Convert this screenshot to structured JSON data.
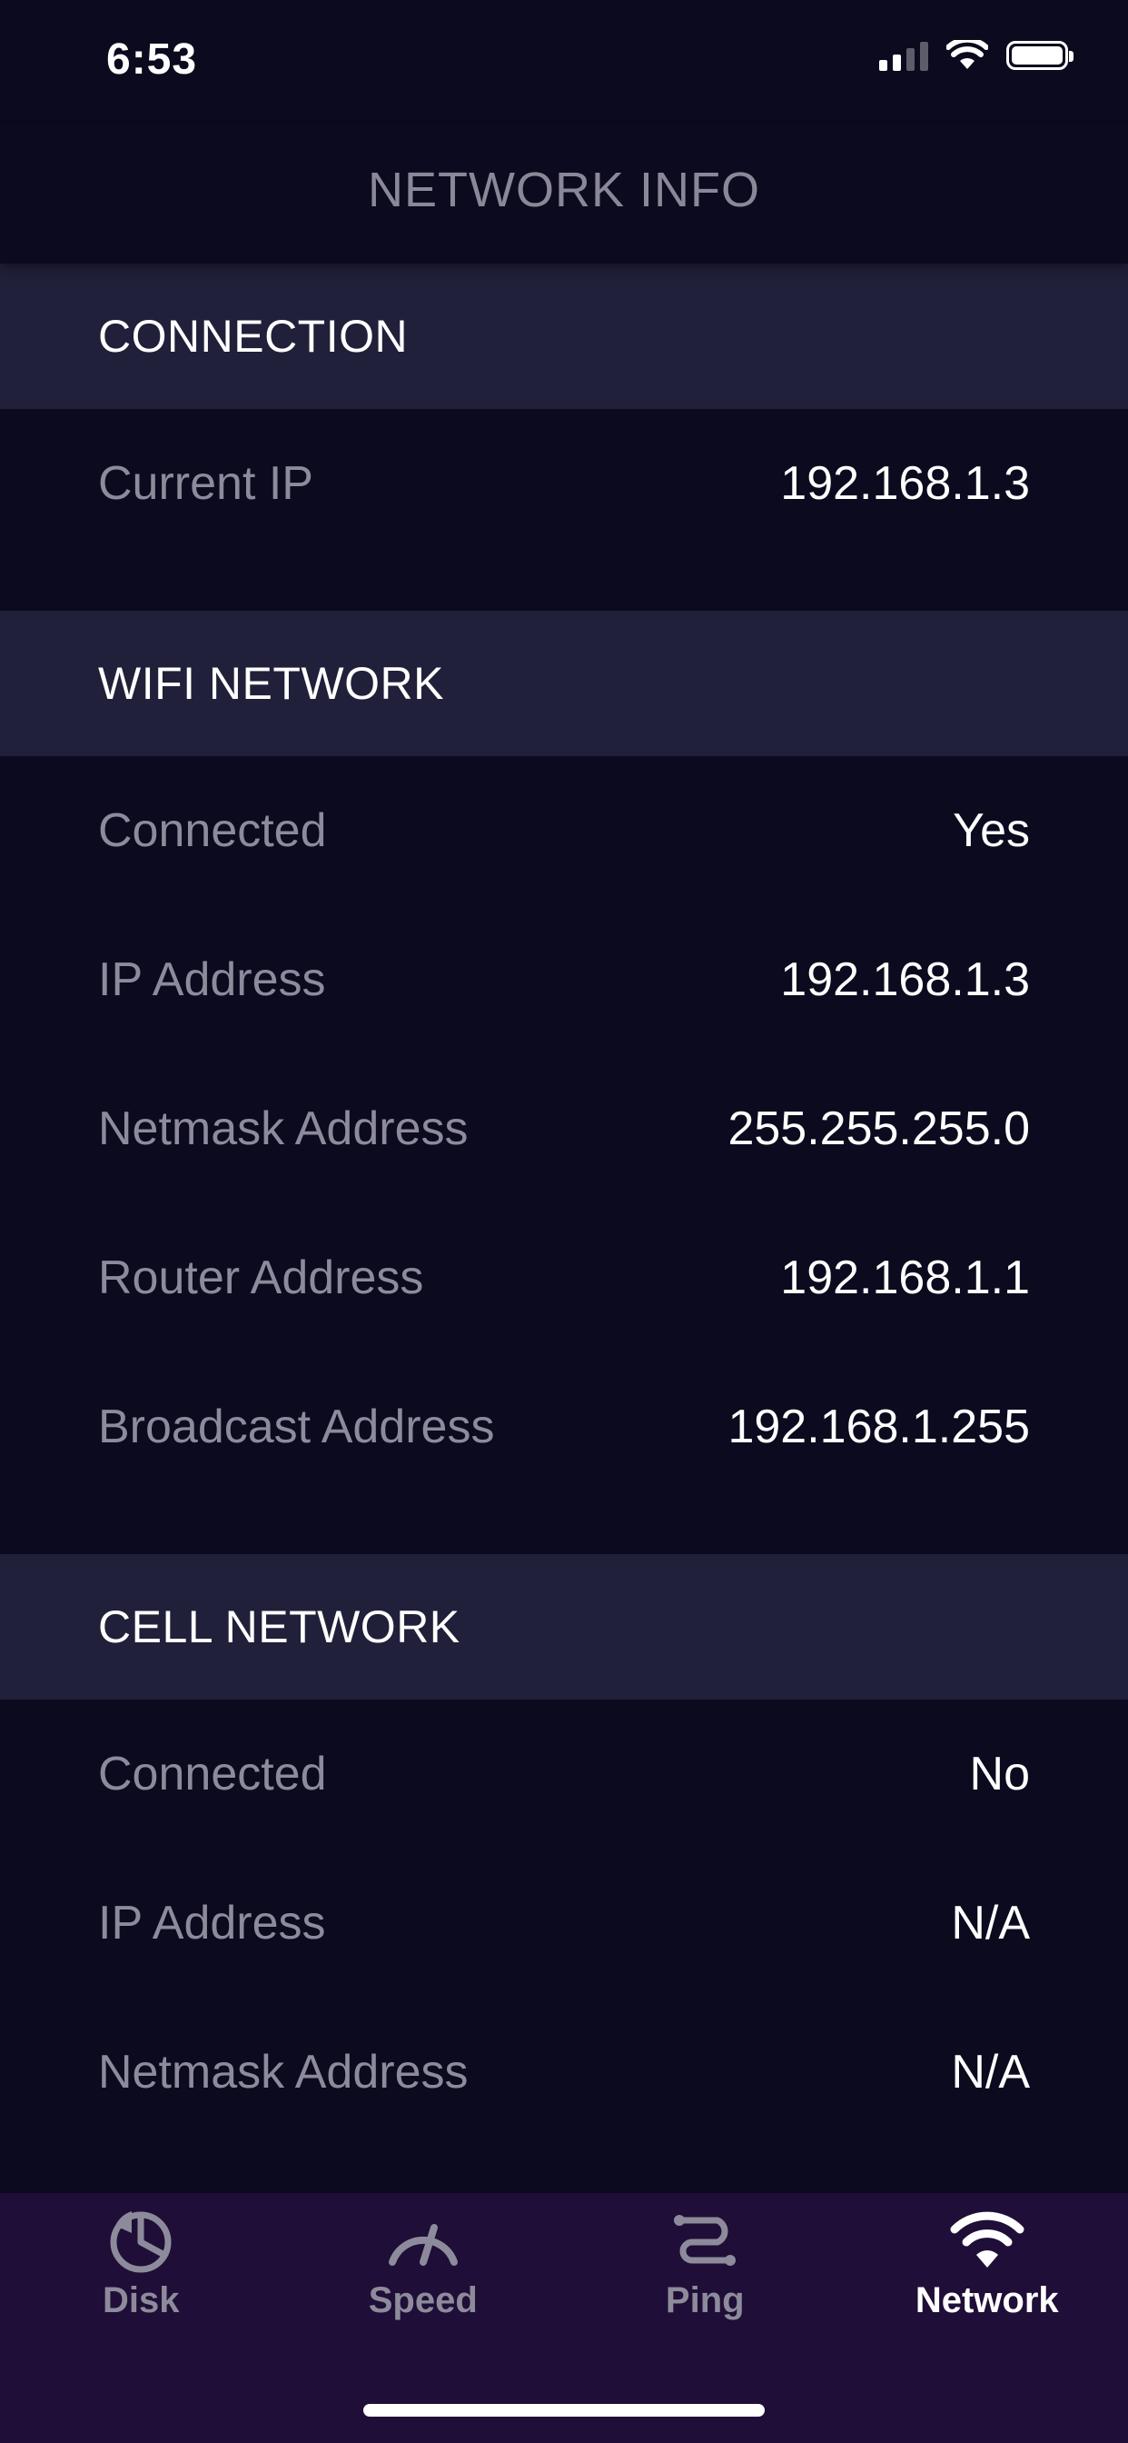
{
  "status_bar": {
    "time": "6:53"
  },
  "nav": {
    "title": "NETWORK INFO"
  },
  "sections": [
    {
      "title": "CONNECTION",
      "rows": [
        {
          "label": "Current IP",
          "value": "192.168.1.3"
        }
      ]
    },
    {
      "title": "WIFI NETWORK",
      "rows": [
        {
          "label": "Connected",
          "value": "Yes"
        },
        {
          "label": "IP Address",
          "value": "192.168.1.3"
        },
        {
          "label": "Netmask Address",
          "value": "255.255.255.0"
        },
        {
          "label": "Router Address",
          "value": "192.168.1.1"
        },
        {
          "label": "Broadcast Address",
          "value": "192.168.1.255"
        }
      ]
    },
    {
      "title": "CELL NETWORK",
      "rows": [
        {
          "label": "Connected",
          "value": "No"
        },
        {
          "label": "IP Address",
          "value": "N/A"
        },
        {
          "label": "Netmask Address",
          "value": "N/A"
        }
      ]
    }
  ],
  "tab_bar": {
    "tabs": [
      {
        "label": "Disk",
        "icon": "pie-chart-icon",
        "active": false
      },
      {
        "label": "Speed",
        "icon": "speedometer-icon",
        "active": false
      },
      {
        "label": "Ping",
        "icon": "ping-route-icon",
        "active": false
      },
      {
        "label": "Network",
        "icon": "wifi-icon",
        "active": true
      }
    ]
  },
  "colors": {
    "background": "#0b0a1e",
    "section_header": "#21203a",
    "tab_bar": "#1f0e37",
    "label": "#8d8b9b",
    "value": "#ffffff"
  }
}
